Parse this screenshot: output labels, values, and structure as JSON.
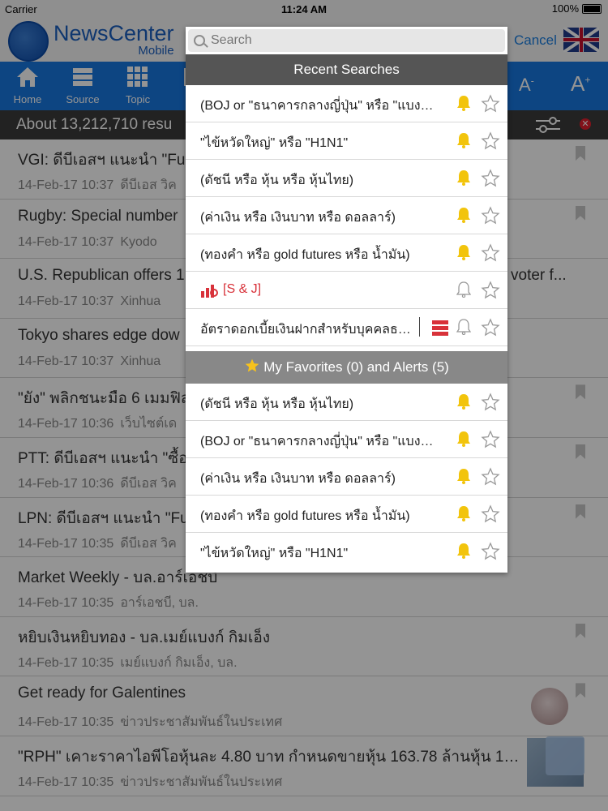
{
  "status": {
    "carrier": "Carrier",
    "time": "11:24 AM",
    "battery": "100%"
  },
  "header": {
    "logo_main": "NewsCenter",
    "logo_sub": "Mobile",
    "cancel": "Cancel"
  },
  "toolbar": {
    "home": "Home",
    "source": "Source",
    "topic": "Topic",
    "font_smaller": "A",
    "font_larger": "A"
  },
  "results": {
    "text": "About 13,212,710 resu"
  },
  "news": [
    {
      "title": "VGI: ดีบีเอสฯ แนะนำ \"Full",
      "time": "14-Feb-17 10:37",
      "source": "ดีบีเอส วิค"
    },
    {
      "title": "Rugby: Special number",
      "time": "14-Feb-17 10:37",
      "source": "Kyodo"
    },
    {
      "title": "U.S. Republican offers 1",
      "title_tail": "voter f...",
      "time": "14-Feb-17 10:37",
      "source": "Xinhua"
    },
    {
      "title": "Tokyo shares edge dow",
      "time": "14-Feb-17 10:37",
      "source": "Xinhua"
    },
    {
      "title": "\"ยัง\" พลิกชนะมือ 6 เมมฟิส",
      "time": "14-Feb-17 10:36",
      "source": "เว็บไซต์เด"
    },
    {
      "title": "PTT: ดีบีเอสฯ แนะนำ \"ซื้อ\"",
      "time": "14-Feb-17 10:36",
      "source": "ดีบีเอส วิค"
    },
    {
      "title": "LPN: ดีบีเอสฯ แนะนำ \"Full",
      "time": "14-Feb-17 10:35",
      "source": "ดีบีเอส วิค"
    },
    {
      "title": "Market Weekly - บล.อาร์เอชบี",
      "time": "14-Feb-17 10:35",
      "source": "อาร์เอชบี, บล."
    },
    {
      "title": "หยิบเงินหยิบทอง - บล.เมย์แบงก์ กิมเอ็ง",
      "time": "14-Feb-17 10:35",
      "source": "เมย์แบงก์ กิมเอ็ง, บล."
    },
    {
      "title": "Get ready for Galentines",
      "time": "14-Feb-17 10:35",
      "source": "ข่าวประชาสัมพันธ์ในประเทศ"
    },
    {
      "title": "\"RPH\" เคาะราคาไอพีโอหุ้นละ 4.80 บาท กำหนดขายหุ้น 163.78 ล้านหุ้น 15-...",
      "time": "14-Feb-17 10:35",
      "source": "ข่าวประชาสัมพันธ์ในประเทศ"
    }
  ],
  "search": {
    "placeholder": "Search",
    "recent_header": "Recent Searches",
    "recent": [
      {
        "text": "(BOJ or \"ธนาคารกลางญี่ปุ่น\" หรือ \"แบงค์ชาติญี่ปุ่น\")",
        "alert": true
      },
      {
        "text": "\"ไข้หวัดใหญ่\" หรือ \"H1N1\"",
        "alert": true
      },
      {
        "text": "(ดัชนี หรือ หุ้น หรือ หุ้นไทย)",
        "alert": true
      },
      {
        "text": "(ค่าเงิน หรือ เงินบาท หรือ ดอลลาร์)",
        "alert": true
      },
      {
        "text": "(ทองคำ หรือ gold futures หรือ น้ำมัน)",
        "alert": true
      },
      {
        "text": "[S & J]",
        "alert": false,
        "type": "stock"
      },
      {
        "text": "อัตราดอกเบี้ยเงินฝากสำหรับบุคคลธรรมดา",
        "alert": false,
        "type": "category"
      }
    ],
    "fav_header": "My Favorites (0) and Alerts (5)",
    "favorites": [
      {
        "text": "(ดัชนี หรือ หุ้น หรือ หุ้นไทย)",
        "alert": true
      },
      {
        "text": "(BOJ or \"ธนาคารกลางญี่ปุ่น\" หรือ \"แบงค์ชาติญี่ปุ่น\")",
        "alert": true
      },
      {
        "text": "(ค่าเงิน หรือ เงินบาท หรือ ดอลลาร์)",
        "alert": true
      },
      {
        "text": "(ทองคำ หรือ gold futures หรือ น้ำมัน)",
        "alert": true
      },
      {
        "text": "\"ไข้หวัดใหญ่\" หรือ \"H1N1\"",
        "alert": true
      }
    ]
  },
  "colors": {
    "toolbar_blue": "#1877e0",
    "alert_yellow": "#f2c40c",
    "accent_red": "#d8323a"
  }
}
